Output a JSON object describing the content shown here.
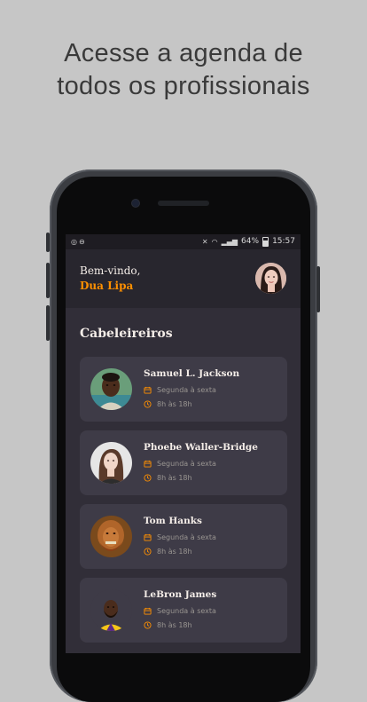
{
  "headline": {
    "line1": "Acesse a agenda de",
    "line2": "todos os profissionais"
  },
  "status_bar": {
    "left_icons": [
      "whatsapp-icon",
      "minus-circle-icon"
    ],
    "battery": "64%",
    "time": "15:57"
  },
  "header": {
    "welcome": "Bem-vindo,",
    "user_name": "Dua Lipa"
  },
  "section": {
    "title": "Cabeleireiros"
  },
  "providers": [
    {
      "name": "Samuel L. Jackson",
      "days": "Segunda à sexta",
      "hours": "8h às 18h"
    },
    {
      "name": "Phoebe Waller-Bridge",
      "days": "Segunda à sexta",
      "hours": "8h às 18h"
    },
    {
      "name": "Tom Hanks",
      "days": "Segunda à sexta",
      "hours": "8h às 18h"
    },
    {
      "name": "LeBron James",
      "days": "Segunda à sexta",
      "hours": "8h às 18h"
    }
  ],
  "colors": {
    "background": "#c6c6c6",
    "screen": "#312e38",
    "card": "#3e3b47",
    "accent": "#ff9000",
    "text": "#f4ede8",
    "muted": "#999591"
  }
}
